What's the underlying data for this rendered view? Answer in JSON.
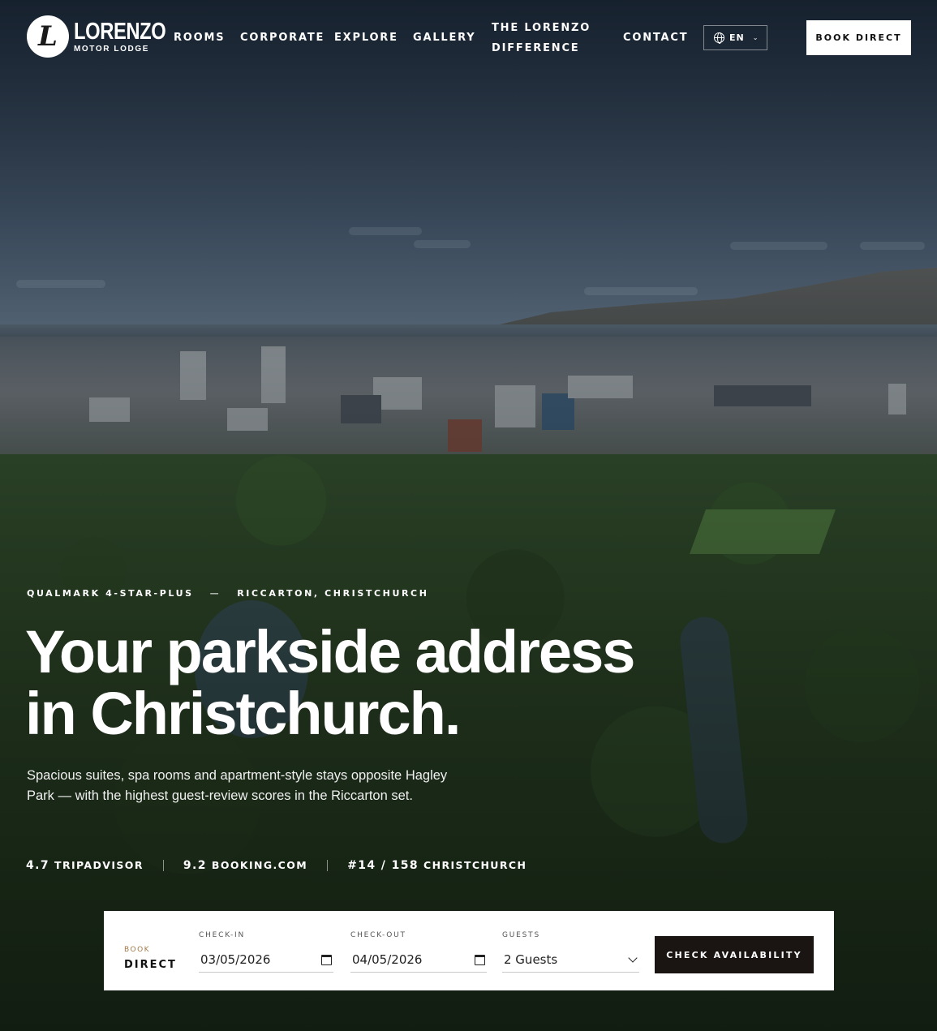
{
  "brand": {
    "mark": "L",
    "name": "LORENZO",
    "subtitle": "MOTOR LODGE"
  },
  "nav": {
    "items": [
      {
        "label": "ROOMS"
      },
      {
        "label": "CORPORATE"
      },
      {
        "label": "EXPLORE"
      },
      {
        "label": "GALLERY"
      },
      {
        "label": "THE LORENZO",
        "label2": "DIFFERENCE"
      },
      {
        "label": "CONTACT"
      }
    ],
    "language": "EN",
    "book_label": "BOOK DIRECT"
  },
  "hero": {
    "eyebrow_left": "QUALMARK 4-STAR-PLUS",
    "eyebrow_sep": "—",
    "eyebrow_right": "RICCARTON, CHRISTCHURCH",
    "headline_line1": "Your parkside address",
    "headline_line2": "in Christchurch.",
    "subcopy": "Spacious suites, spa rooms and apartment-style stays opposite Hagley Park — with the highest guest-review scores in the Riccarton set.",
    "ratings": [
      {
        "value": "4.7",
        "label": "TRIPADVISOR"
      },
      {
        "value": "9.2",
        "label": "BOOKING.COM"
      },
      {
        "value": "#14 / 158",
        "label": "CHRISTCHURCH"
      }
    ]
  },
  "booking": {
    "label_small": "BOOK",
    "label_big": "DIRECT",
    "checkin_caption": "CHECK-IN",
    "checkin_value": "03/05/2026",
    "checkout_caption": "CHECK-OUT",
    "checkout_value": "04/05/2026",
    "guests_caption": "GUESTS",
    "guests_value": "2 Guests",
    "submit_label": "CHECK AVAILABILITY"
  },
  "colors": {
    "accent_gold": "#a07a4a",
    "button_dark": "#1a1412",
    "white": "#ffffff"
  }
}
